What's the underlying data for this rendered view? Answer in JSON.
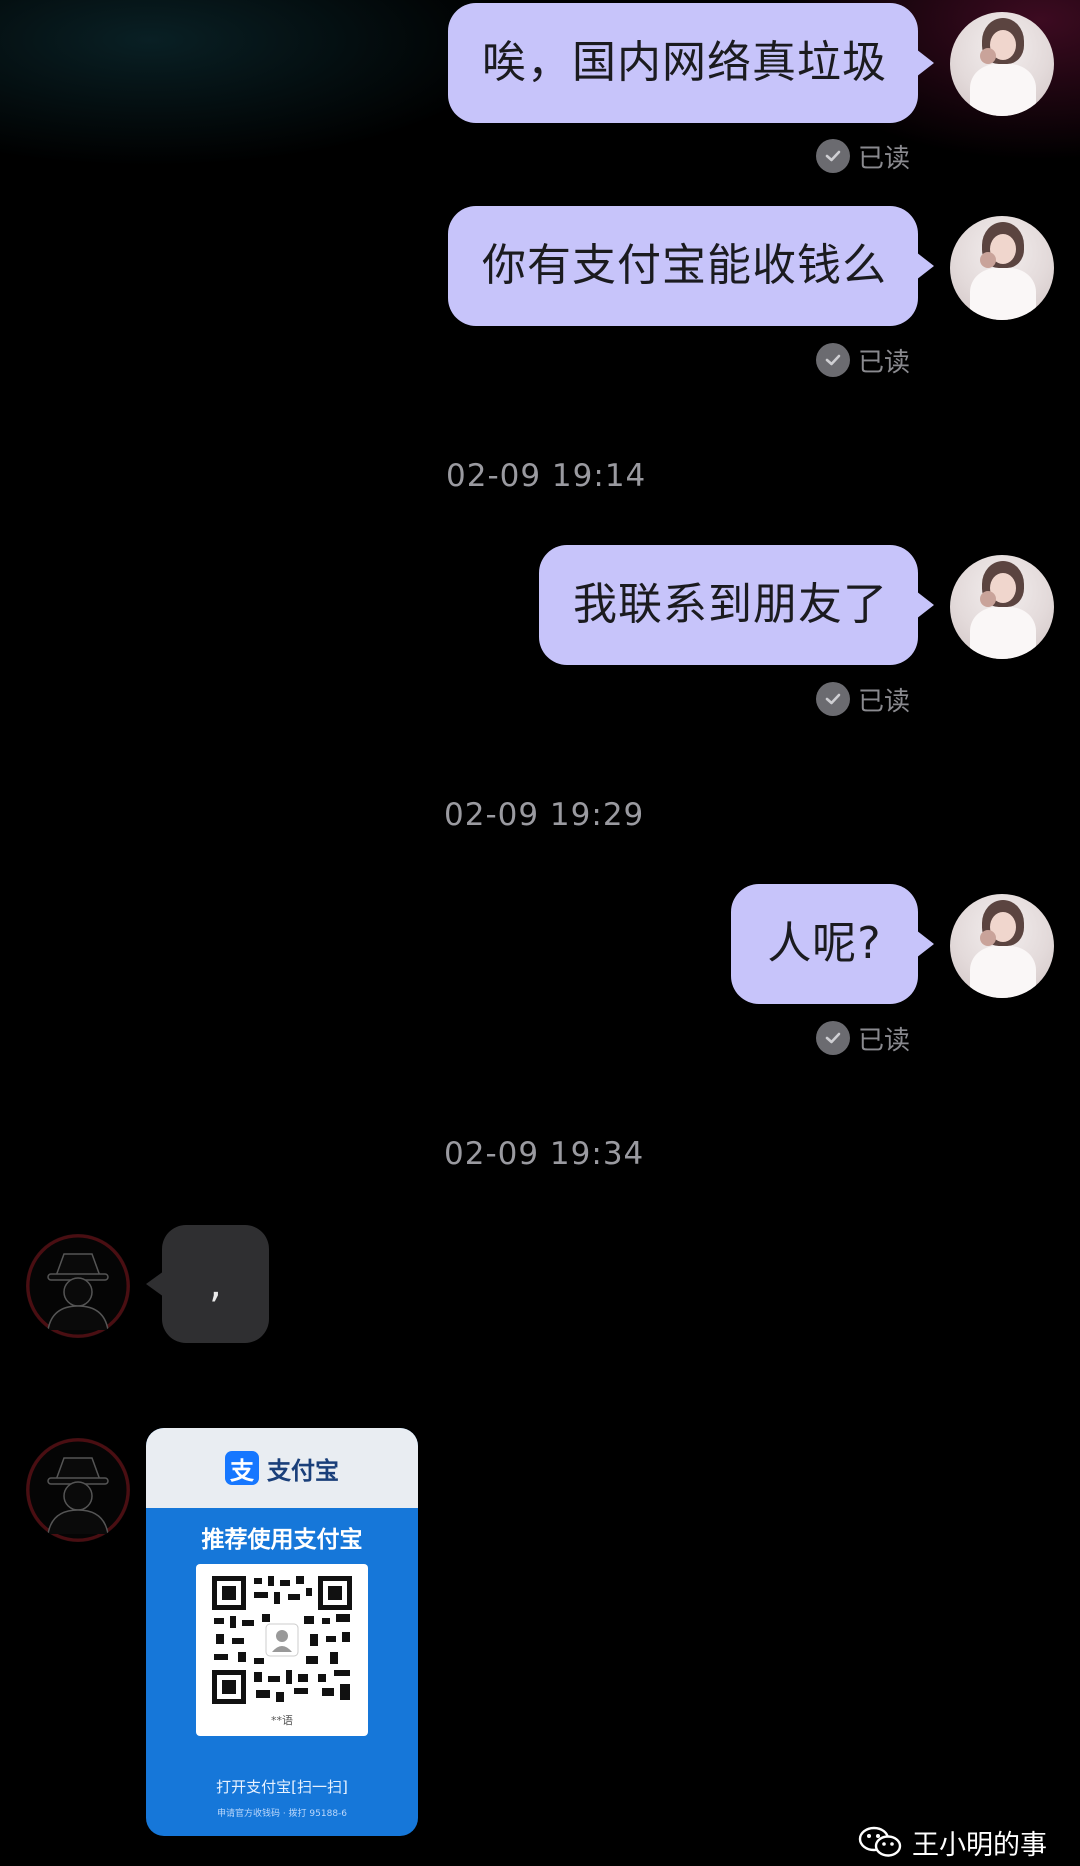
{
  "messages": [
    {
      "text": "唉，国内网络真垃圾",
      "read": "已读"
    },
    {
      "text": "你有支付宝能收钱么",
      "read": "已读"
    },
    {
      "timestamp": "02-09  19:14"
    },
    {
      "text": "我联系到朋友了",
      "read": "已读"
    },
    {
      "timestamp": "02-09  19:29"
    },
    {
      "text": "人呢?",
      "read": "已读"
    },
    {
      "timestamp": "02-09  19:34"
    },
    {
      "incoming_text": ","
    }
  ],
  "qr_card": {
    "logo_char": "支",
    "brand": "支付宝",
    "title": "推荐使用支付宝",
    "user_name": "**语",
    "scan_hint": "打开支付宝[扫一扫]",
    "fine_print": "申请官方收钱码 · 拨打 95188-6"
  },
  "watermark": {
    "text": "王小明的事",
    "icon": "wechat-icon"
  },
  "colors": {
    "outgoing_bubble": "#c7c4fa",
    "incoming_bubble": "#2f2f31",
    "background": "#000000",
    "alipay_blue": "#1677d9"
  }
}
